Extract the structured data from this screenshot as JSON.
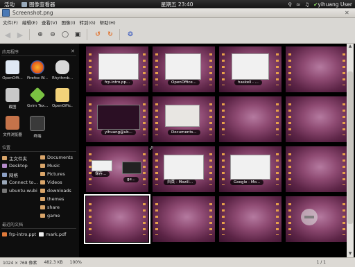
{
  "panel": {
    "activities": "活动",
    "app_menu": "图像查看器",
    "clock": "星期五 23:40",
    "user": "yihuang User"
  },
  "window": {
    "title": "Screenshot.png"
  },
  "menubar": [
    "文件(F)",
    "编辑(E)",
    "查看(V)",
    "图像(I)",
    "转到(G)",
    "帮助(H)"
  ],
  "sidebar": {
    "apps_title": "应用程序",
    "apps": [
      {
        "label": "OpenOffi...",
        "color": "#dfe8f4"
      },
      {
        "label": "Firefox W...",
        "color": "#e96a1b"
      },
      {
        "label": "Rhythmb...",
        "color": "#dcdcdc"
      },
      {
        "label": "截图",
        "color": "#c9c9c9"
      },
      {
        "label": "Gvim Tex...",
        "color": "#7ac142"
      },
      {
        "label": "OpenOffic...",
        "color": "#f2d27a"
      },
      {
        "label": "文件浏览器",
        "color": "#c5734a"
      },
      {
        "label": "终端",
        "color": "#3a3a3a"
      }
    ],
    "places_title": "位置",
    "places_left": [
      "主文件夹",
      "Desktop",
      "网络",
      "Connect to...",
      "ubuntu-wubi"
    ],
    "places_right": [
      "Documents",
      "Music",
      "Pictures",
      "Videos",
      "downloads",
      "themes",
      "share",
      "game"
    ],
    "recent_title": "最近的文档",
    "recent": [
      "frp-intro.ppt",
      "mark.pdf"
    ]
  },
  "thumbnails": [
    {
      "caption": "frp-intro.pp..."
    },
    {
      "caption": "OpenOffice..."
    },
    {
      "caption": "haskell - ..."
    },
    {
      "caption": ""
    },
    {
      "caption": "yihuang@ub..."
    },
    {
      "caption": "Documents..."
    },
    {
      "caption": ""
    },
    {
      "caption": ""
    },
    {
      "caption": "保存..."
    },
    {
      "caption": "白菜 - Mozill..."
    },
    {
      "caption": "Google - Mo..."
    },
    {
      "caption": ""
    },
    {
      "caption": ""
    },
    {
      "caption": ""
    },
    {
      "caption": ""
    },
    {
      "caption": ""
    }
  ],
  "thumb_extra_caption": "ge...",
  "status": {
    "dimensions": "1024 × 768 像素",
    "size": "482.3 KB",
    "zoom": "100%",
    "page": "1 / 1"
  }
}
